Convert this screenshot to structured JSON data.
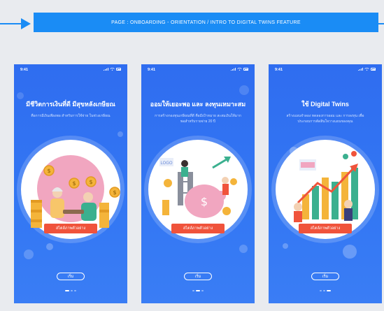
{
  "header": {
    "label": "PAGE : ONBOARDING - ORIENTATION / INTRO TO DIGITAL TWINS FEATURE",
    "color": "#1a8cf5"
  },
  "screens": [
    {
      "time": "9:41",
      "title": "มีชีวิตการเงินที่ดี มีสุขหลังเกษียณ",
      "description": "คือการมีเงินเพียงพอ สำหรับการใช้จ่าย ในช่วงเกษียณ",
      "chip": "สไตล์ภาพตัวอย่าง",
      "start": "เริ่ม",
      "active_dot": 0
    },
    {
      "time": "9:41",
      "title": "ออมให้เยอะพอ และ ลงทุนเหมาะสม",
      "description": "การสร้างกองทุนเกษียณที่ดี คือมีเป้าหมาย สะสมเงินให้มากพอสำหรับรายจ่าย 20 ปี",
      "chip": "สไตล์ภาพตัวอย่าง",
      "start": "เริ่ม",
      "active_dot": 1
    },
    {
      "time": "9:41",
      "title": "ใช้ Digital Twins",
      "description": "สร้างแผนจำลอง ทดลองการออม และ การลงทุน เพื่อประกอบการตัดสินใจวางแผนของคุณ",
      "chip": "สไตล์ภาพตัวอย่าง",
      "start": "เริ่ม",
      "active_dot": 2
    }
  ],
  "colors": {
    "screen_bg": "#3377f3",
    "chip": "#f0533b",
    "coin": "#f4b43a"
  }
}
